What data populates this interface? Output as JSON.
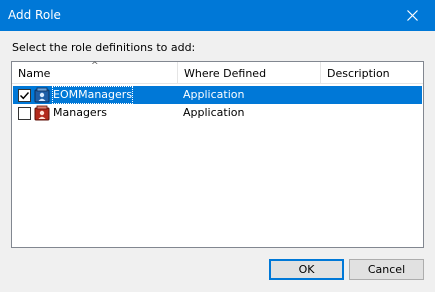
{
  "window": {
    "title": "Add Role",
    "close_icon": "close-icon"
  },
  "prompt": "Select the role definitions to add:",
  "columns": [
    {
      "label": "Name"
    },
    {
      "label": "Where Defined"
    },
    {
      "label": "Description"
    }
  ],
  "rows": [
    {
      "name": "EOMManagers",
      "where": "Application",
      "description": "",
      "checked": true,
      "selected": true,
      "icon": "role-icon"
    },
    {
      "name": "Managers",
      "where": "Application",
      "description": "",
      "checked": false,
      "selected": false,
      "icon": "role-icon"
    }
  ],
  "buttons": {
    "ok": "OK",
    "cancel": "Cancel"
  },
  "colors": {
    "accent": "#0078d7",
    "dialog_bg": "#f0f0f0"
  }
}
